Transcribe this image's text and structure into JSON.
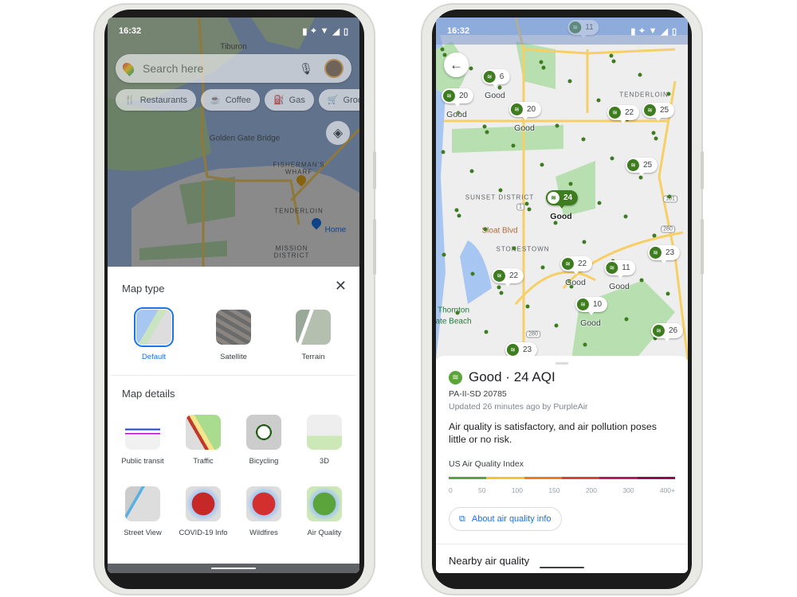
{
  "colors": {
    "accent": "#1a73e8",
    "aqi_good": "#3e7d1f",
    "water": "#a7c7f2",
    "park": "#b7dfb0",
    "road": "#f6cf65",
    "land": "#eeeeee"
  },
  "left_phone": {
    "status": {
      "time": "16:32",
      "icons": [
        "briefcase-icon",
        "location-icon",
        "wifi-icon",
        "signal-icon",
        "battery-icon"
      ]
    },
    "search": {
      "placeholder": "Search here",
      "mic_icon": "mic-icon",
      "avatar": "avatar"
    },
    "chips": [
      {
        "label": "Restaurants",
        "icon": "restaurant-icon"
      },
      {
        "label": "Coffee",
        "icon": "coffee-icon"
      },
      {
        "label": "Gas",
        "icon": "gas-icon"
      },
      {
        "label": "Grocer",
        "icon": "cart-icon"
      }
    ],
    "map_labels": [
      "Tiburon",
      "Golden Gate Bridge",
      "FISHERMAN'S",
      "WHARF",
      "TENDERLOIN",
      "Home",
      "MISSION",
      "DISTRICT"
    ],
    "sheet": {
      "map_type_title": "Map type",
      "map_types": [
        {
          "label": "Default",
          "selected": true
        },
        {
          "label": "Satellite",
          "selected": false
        },
        {
          "label": "Terrain",
          "selected": false
        }
      ],
      "map_details_title": "Map details",
      "details": [
        {
          "label": "Public transit"
        },
        {
          "label": "Traffic"
        },
        {
          "label": "Bicycling"
        },
        {
          "label": "3D"
        },
        {
          "label": "Street View"
        },
        {
          "label": "COVID-19 Info"
        },
        {
          "label": "Wildfires"
        },
        {
          "label": "Air Quality"
        }
      ]
    }
  },
  "right_phone": {
    "status": {
      "time": "16:32"
    },
    "map_labels": [
      "TENDERLOIN",
      "SUNSET DISTRICT",
      "Sloat Blvd",
      "STONESTOWN",
      "Thornton",
      "ate Beach",
      "1",
      "101",
      "280",
      "280"
    ],
    "markers": [
      {
        "value": "11",
        "label": ""
      },
      {
        "value": "6",
        "label": "Good"
      },
      {
        "value": "20",
        "label": "Good"
      },
      {
        "value": "20",
        "label": "Good"
      },
      {
        "value": "22",
        "label": ""
      },
      {
        "value": "25",
        "label": ""
      },
      {
        "value": "25",
        "label": ""
      },
      {
        "value": "24",
        "label": "Good",
        "selected": true
      },
      {
        "value": "22",
        "label": "Good"
      },
      {
        "value": "11",
        "label": "Good"
      },
      {
        "value": "23",
        "label": ""
      },
      {
        "value": "22",
        "label": ""
      },
      {
        "value": "10",
        "label": "Good"
      },
      {
        "value": "26",
        "label": ""
      },
      {
        "value": "23",
        "label": ""
      }
    ],
    "panel": {
      "title": "Good · 24 AQI",
      "station": "PA-II-SD 20785",
      "updated": "Updated 26 minutes ago by PurpleAir",
      "description": "Air quality is satisfactory, and air pollution poses little or no risk.",
      "index_title": "US Air Quality Index",
      "scale_ticks": [
        "0",
        "50",
        "100",
        "150",
        "200",
        "300",
        "400+"
      ],
      "scale_colors": [
        "#5ba33b",
        "#f6c431",
        "#ee7b1d",
        "#d14531",
        "#b8195c",
        "#8c0f4b"
      ],
      "link": "About air quality info",
      "nearby": "Nearby air quality"
    }
  }
}
